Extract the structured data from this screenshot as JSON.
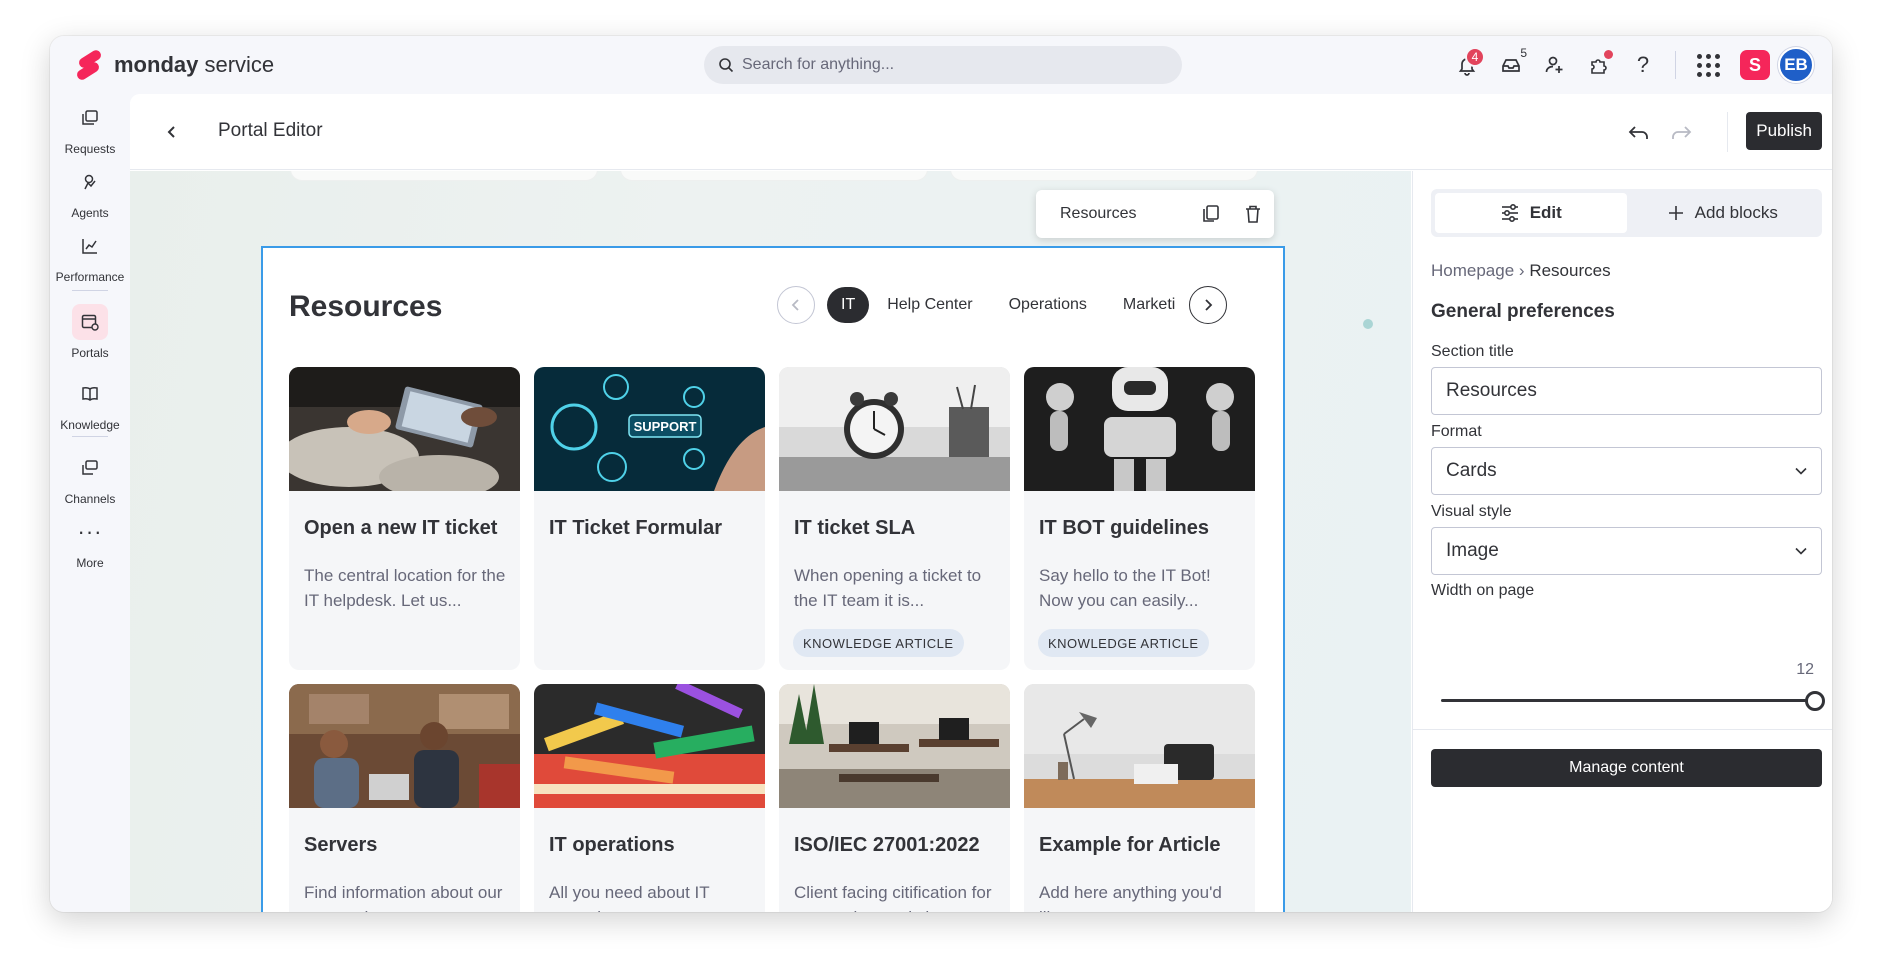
{
  "app": {
    "brand_bold": "monday",
    "brand_light": " service"
  },
  "search": {
    "placeholder": "Search for anything..."
  },
  "top_icons": {
    "notifications_count": "4",
    "inbox_count": "5",
    "avatar_initials": "EB",
    "app_tile_letter": "S"
  },
  "sidebar": {
    "items": [
      {
        "label": "Requests",
        "icon": "requests-icon"
      },
      {
        "label": "Agents",
        "icon": "agents-icon"
      },
      {
        "label": "Performance",
        "icon": "performance-icon"
      },
      {
        "label": "Portals",
        "icon": "portals-icon",
        "active": true
      },
      {
        "label": "Knowledge",
        "icon": "knowledge-icon"
      },
      {
        "label": "Channels",
        "icon": "channels-icon"
      },
      {
        "label": "More",
        "icon": "more-icon"
      }
    ]
  },
  "editor": {
    "title": "Portal Editor",
    "publish_label": "Publish"
  },
  "block_toolbar": {
    "label": "Resources"
  },
  "section": {
    "title": "Resources",
    "tabs": [
      "IT",
      "Help Center",
      "Operations",
      "Marketi"
    ],
    "active_tab": "IT",
    "cards": [
      {
        "title": "Open a new IT ticket",
        "desc": "The central location for the IT helpdesk. Let us...",
        "tag": "",
        "image": "person-with-tablet-photo"
      },
      {
        "title": "IT Ticket Formular",
        "desc": "",
        "tag": "",
        "image": "support-hologram-photo",
        "image_text": "SUPPORT"
      },
      {
        "title": "IT ticket SLA",
        "desc": "When opening a ticket to the IT team it is...",
        "tag": "KNOWLEDGE ARTICLE",
        "image": "alarm-clock-photo"
      },
      {
        "title": "IT BOT guidelines",
        "desc": "Say hello to the IT Bot! Now you can easily...",
        "tag": "KNOWLEDGE ARTICLE",
        "image": "robot-photo"
      },
      {
        "title": "Servers",
        "desc": "Find information about our servers here",
        "tag": "",
        "image": "office-people-photo"
      },
      {
        "title": "IT operations",
        "desc": "All you need about IT operations",
        "tag": "",
        "image": "stationery-photo"
      },
      {
        "title": "ISO/IEC 27001:2022",
        "desc": "Client facing citification for you to view and share",
        "tag": "",
        "image": "office-desks-photo"
      },
      {
        "title": "Example for Article",
        "desc": "Add here anything you'd like",
        "tag": "",
        "image": "desk-lamp-photo"
      }
    ]
  },
  "panel": {
    "edit_label": "Edit",
    "add_blocks_label": "Add blocks",
    "breadcrumb_root": "Homepage",
    "breadcrumb_sep": "›",
    "breadcrumb_current": "Resources",
    "pref_title": "General preferences",
    "section_title_label": "Section title",
    "section_title_value": "Resources",
    "format_label": "Format",
    "format_value": "Cards",
    "visual_style_label": "Visual style",
    "visual_style_value": "Image",
    "width_label": "Width on page",
    "width_value": "12",
    "width_fraction": 1.0,
    "manage_label": "Manage content"
  },
  "colors": {
    "brand": "#f5265a",
    "selection_border": "#3a9be8",
    "dark_button": "#2b2c30",
    "avatar": "#1f5fc8"
  }
}
